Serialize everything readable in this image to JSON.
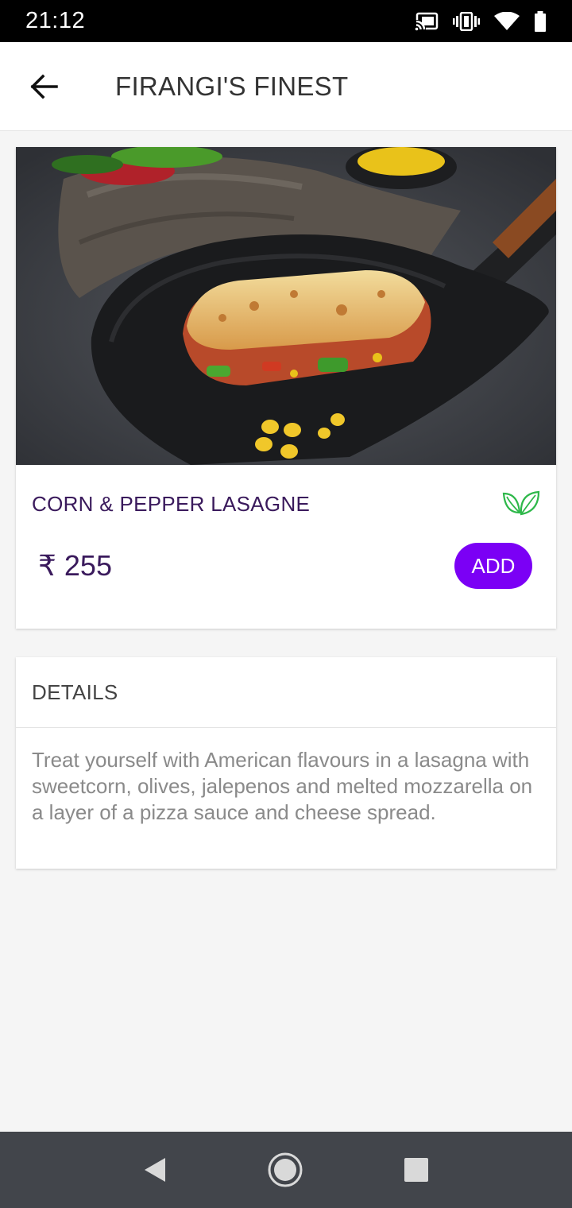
{
  "status_bar": {
    "time": "21:12",
    "icons": [
      "cast-icon",
      "vibrate-icon",
      "wifi-icon",
      "battery-icon"
    ]
  },
  "app_bar": {
    "back_icon": "arrow-back-icon",
    "title": "FIRANGI'S FINEST"
  },
  "product": {
    "name": "CORN & PEPPER LASAGNE",
    "price": "₹ 255",
    "add_label": "ADD",
    "veg_icon": "leaf-icon",
    "colors": {
      "name": "#3a1a5c",
      "add_button": "#7b00f5",
      "veg_icon": "#2eb84a"
    }
  },
  "details": {
    "heading": "DETAILS",
    "description": "Treat yourself with American flavours in a lasagna with sweetcorn, olives, jalepenos and melted mozzarella on a layer of a pizza sauce and cheese spread."
  },
  "nav_bar": {
    "icons": [
      "nav-back-icon",
      "nav-home-icon",
      "nav-recents-icon"
    ]
  }
}
